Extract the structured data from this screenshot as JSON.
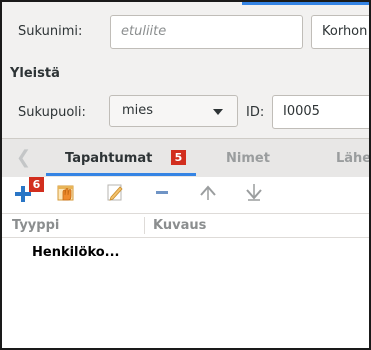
{
  "person": {
    "surname_label": "Sukunimi:",
    "prefix_placeholder": "etuliite",
    "surname_value": "Korhon",
    "section_title": "Yleistä",
    "gender_label": "Sukupuoli:",
    "gender_value": "mies",
    "id_label": "ID:",
    "id_value": "I0005"
  },
  "tabs": {
    "items": [
      {
        "label": "Tapahtumat",
        "active": true
      },
      {
        "label": "Nimet",
        "active": false
      },
      {
        "label": "Lähe",
        "active": false
      }
    ],
    "badge": "5"
  },
  "toolbar": {
    "badge": "6",
    "buttons": [
      "add-icon",
      "share-icon",
      "edit-icon",
      "remove-icon",
      "move-up-icon",
      "move-down-icon"
    ]
  },
  "events_table": {
    "columns": [
      "Tyyppi",
      "Kuvaus"
    ],
    "rows": [
      {
        "type": "Henkilöko..."
      }
    ]
  },
  "colors": {
    "accent": "#3584e4",
    "badge": "#d22e1e",
    "add_icon": "#2a76c6"
  }
}
